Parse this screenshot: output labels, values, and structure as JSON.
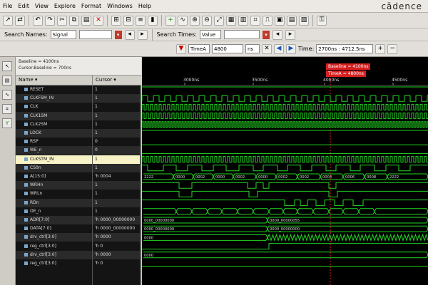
{
  "menu": [
    "File",
    "Edit",
    "View",
    "Explore",
    "Format",
    "Windows",
    "Help"
  ],
  "brand": "cādence",
  "search_names": {
    "label": "Search Names:",
    "value": "Signal"
  },
  "search_times": {
    "label": "Search Times:",
    "value": "Value"
  },
  "time_controls": {
    "time_a_label": "TimeA",
    "time_a_value": "4800",
    "units": "ns",
    "time_label": "Time:",
    "time_range": "2700ns : 4712.5ns"
  },
  "cursor_info": {
    "baseline": "Baseline = 4100ns",
    "cursor_baseline": "Cursor-Baseline = 700ns"
  },
  "columns": {
    "name": "Name",
    "cursor": "Cursor"
  },
  "timeline": {
    "ticks": [
      "3000ns",
      "3500ns",
      "4000ns",
      "4500ns"
    ],
    "baseline_marker": "Baseline = 4100ns",
    "timea_marker": "TimeA = 4800ns"
  },
  "signals": [
    {
      "name": "RESET",
      "cursor": "1",
      "kind": "flat_high"
    },
    {
      "name": "CLKFSM_IN",
      "cursor": "1",
      "kind": "clock_slow"
    },
    {
      "name": "CLK",
      "cursor": "1",
      "kind": "clock_fast"
    },
    {
      "name": "CLK1SM",
      "cursor": "1",
      "kind": "clock_fast"
    },
    {
      "name": "CLK2SM",
      "cursor": "1",
      "kind": "clock_fast2"
    },
    {
      "name": "LOCK",
      "cursor": "1",
      "kind": "flat_high"
    },
    {
      "name": "RSP",
      "cursor": "0",
      "kind": "flat_low"
    },
    {
      "name": "WE_n",
      "cursor": "0",
      "kind": "flat_low"
    },
    {
      "name": "CLKSTM_IN",
      "cursor": "1",
      "kind": "clock_fast"
    },
    {
      "name": "CS0n",
      "cursor": "1",
      "kind": "pulses"
    },
    {
      "name": "A[15:0]",
      "cursor": "'h 0004",
      "kind": "bus",
      "labels": [
        "2222",
        "0000",
        "0002",
        "0000",
        "0002",
        "0000",
        "0002",
        "0002",
        "0004",
        "0006",
        "0008",
        "2222"
      ]
    },
    {
      "name": "WRHn",
      "cursor": "1",
      "kind": "pulses2"
    },
    {
      "name": "WRLn",
      "cursor": "1",
      "kind": "pulses3"
    },
    {
      "name": "RDn",
      "cursor": "1",
      "kind": "pulses4"
    },
    {
      "name": "OE_n",
      "cursor": "1",
      "kind": "bus_small"
    },
    {
      "name": "ADR[7:0]",
      "cursor": "'h 0000_00000000",
      "kind": "bus",
      "labels": [
        "0000_00000000",
        "0000_00000055"
      ]
    },
    {
      "name": "DATA[7:0]",
      "cursor": "'h 0000_00000000",
      "kind": "bus",
      "labels": [
        "0000_00000000",
        "0000_00000000"
      ]
    },
    {
      "name": "drv_ctrl[3:0]",
      "cursor": "'h 0000",
      "kind": "busy",
      "labels": [
        "0000"
      ]
    },
    {
      "name": "reg_ctrl[3:0]",
      "cursor": "'h 0",
      "kind": "step"
    },
    {
      "name": "drv_ctrl[3:0]",
      "cursor": "'h 0000",
      "kind": "flat_bus",
      "labels": [
        "0000"
      ]
    },
    {
      "name": "reg_ctrl[3:0]",
      "cursor": "'h 0",
      "kind": "flat_low"
    }
  ],
  "colors": {
    "wave": "#22d822",
    "bus_text": "#d8d8d8",
    "marker": "#d62020",
    "highlight": "#f7f3c6"
  }
}
